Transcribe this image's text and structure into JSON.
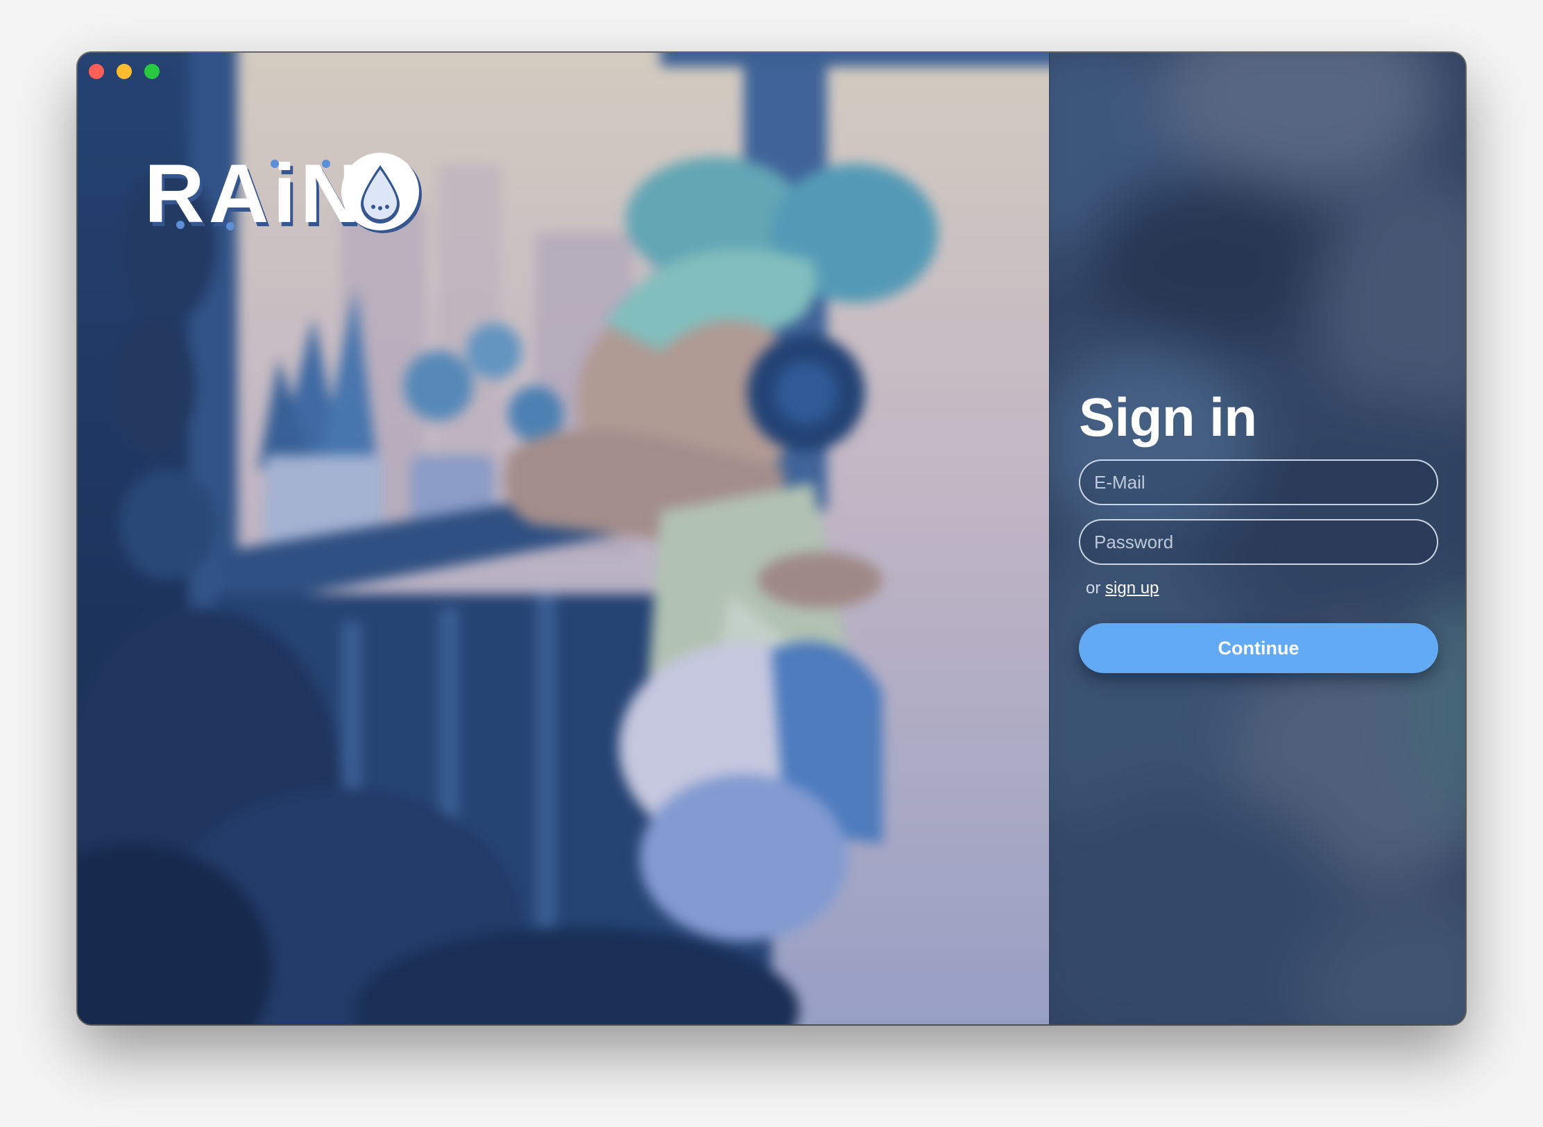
{
  "app": {
    "logo_text": "RAiNO"
  },
  "login": {
    "title": "Sign in",
    "email_placeholder": "E-Mail",
    "email_value": "",
    "password_placeholder": "Password",
    "password_value": "",
    "alt_prefix": "or",
    "signup_label": "sign up",
    "continue_label": "Continue"
  },
  "colors": {
    "accent": "#62aaf3",
    "traffic_close": "#fe5f57",
    "traffic_minimize": "#febc2e",
    "traffic_maximize": "#28c840"
  }
}
